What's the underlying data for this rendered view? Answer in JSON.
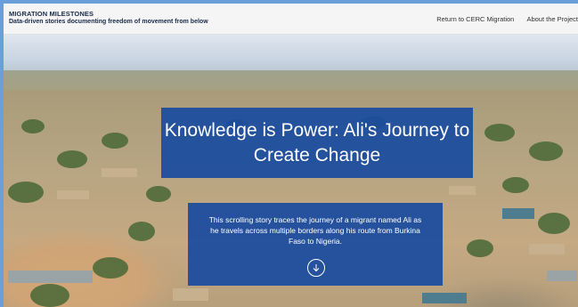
{
  "header": {
    "title": "MIGRATION MILESTONES",
    "subtitle": "Data-driven stories documenting freedom of movement from below",
    "nav": [
      {
        "label": "Return to CERC Migration"
      },
      {
        "label": "About the Project"
      }
    ]
  },
  "hero": {
    "title": "Knowledge is Power: Ali's Journey to Create Change",
    "description": "This scrolling story traces the journey of a migrant named Ali as he travels across multiple borders along his route from Burkina Faso to Nigeria.",
    "scroll_icon": "arrow-down-circle-icon"
  },
  "colors": {
    "overlay": "#194ba0",
    "header_bg": "#f5f5f5",
    "page_border": "#6b9fd9"
  }
}
